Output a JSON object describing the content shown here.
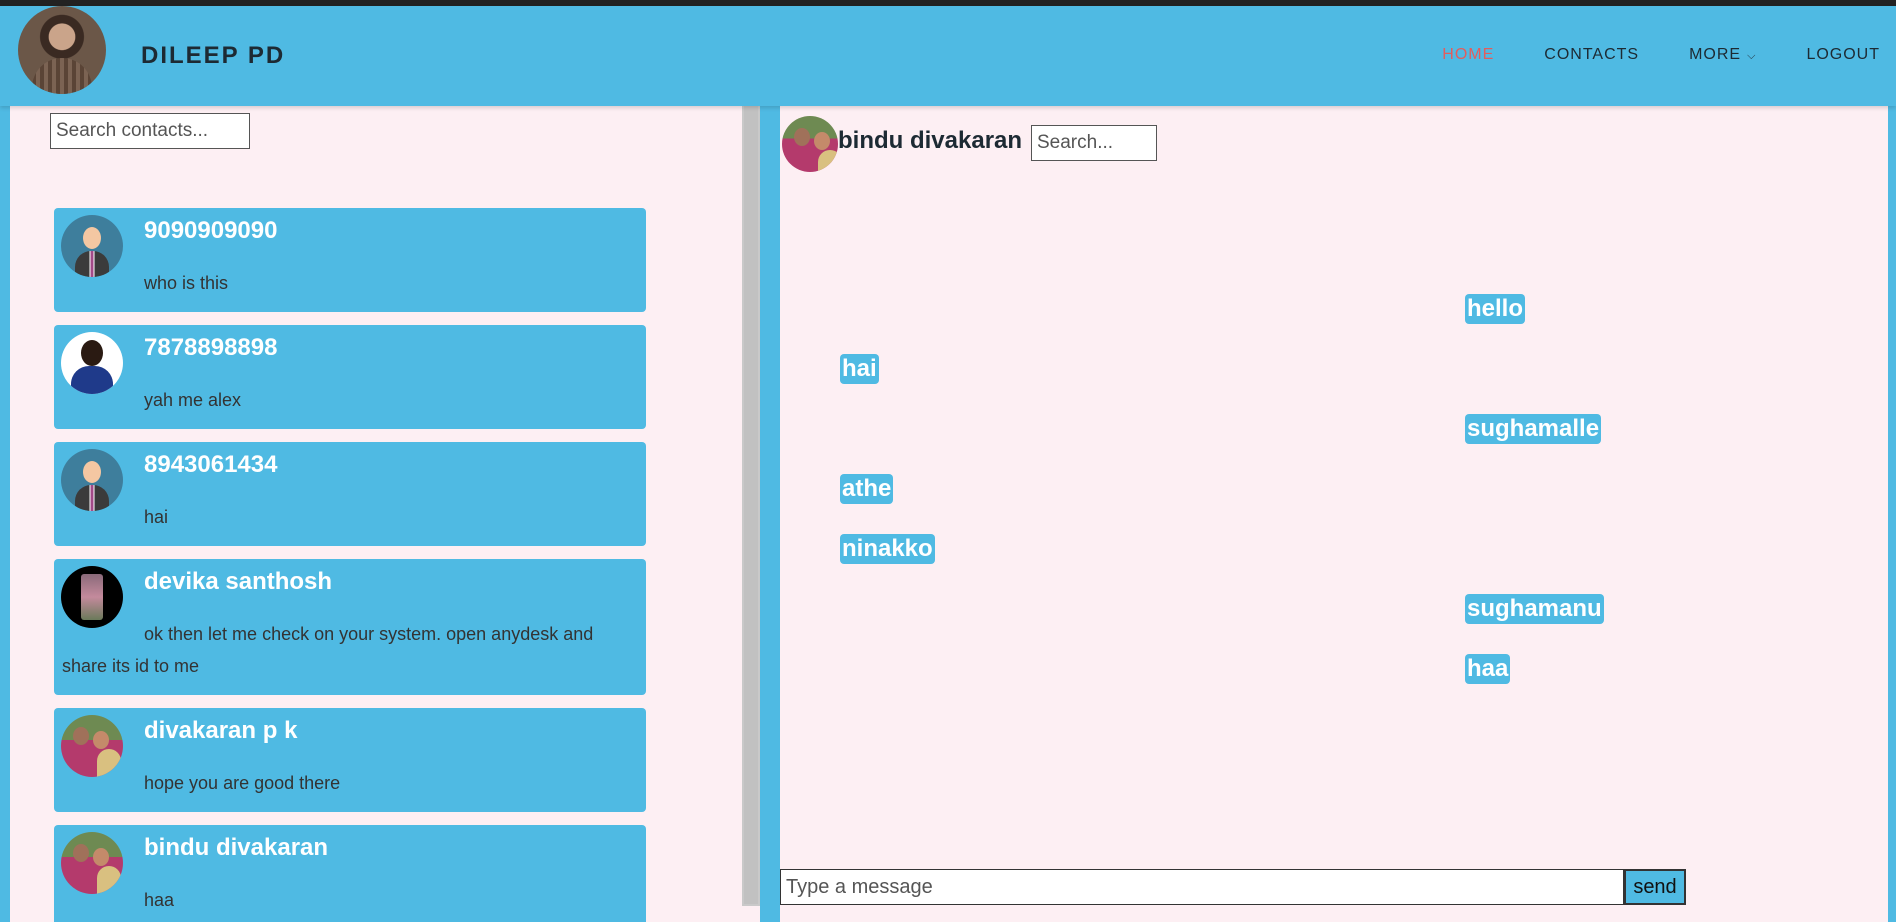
{
  "header": {
    "brand": "DILEEP PD",
    "nav": [
      {
        "label": "HOME"
      },
      {
        "label": "CONTACTS"
      },
      {
        "label": "MORE"
      },
      {
        "label": "LOGOUT"
      }
    ],
    "active_color": "#e35d5d"
  },
  "sidebar": {
    "search_placeholder": "Search contacts...",
    "contacts": [
      {
        "name": "9090909090",
        "last_message": "who is this",
        "avatar": "default-avatar"
      },
      {
        "name": "7878898898",
        "last_message": "yah me alex",
        "avatar": "photo-avatar"
      },
      {
        "name": "8943061434",
        "last_message": "hai",
        "avatar": "default-avatar"
      },
      {
        "name": "devika santhosh",
        "last_message": "ok then let me check on your system. open anydesk and share its id to me",
        "avatar": "photo-avatar"
      },
      {
        "name": "divakaran p k",
        "last_message": "hope you are good there",
        "avatar": "photo-avatar"
      },
      {
        "name": "bindu divakaran",
        "last_message": "haa",
        "avatar": "photo-avatar"
      }
    ]
  },
  "chat": {
    "contact_name": "bindu divakaran",
    "search_placeholder": "Search...",
    "messages": [
      {
        "text": "hello",
        "from": "me"
      },
      {
        "text": "hai",
        "from": "them"
      },
      {
        "text": "sughamalle",
        "from": "me"
      },
      {
        "text": "athe",
        "from": "them"
      },
      {
        "text": "ninakko",
        "from": "them"
      },
      {
        "text": "sughamanu",
        "from": "me"
      },
      {
        "text": "haa",
        "from": "me"
      }
    ],
    "input_placeholder": "Type a message",
    "send_label": "send"
  },
  "colors": {
    "primary": "#4fbae3",
    "panel_background": "#fdeff3"
  }
}
